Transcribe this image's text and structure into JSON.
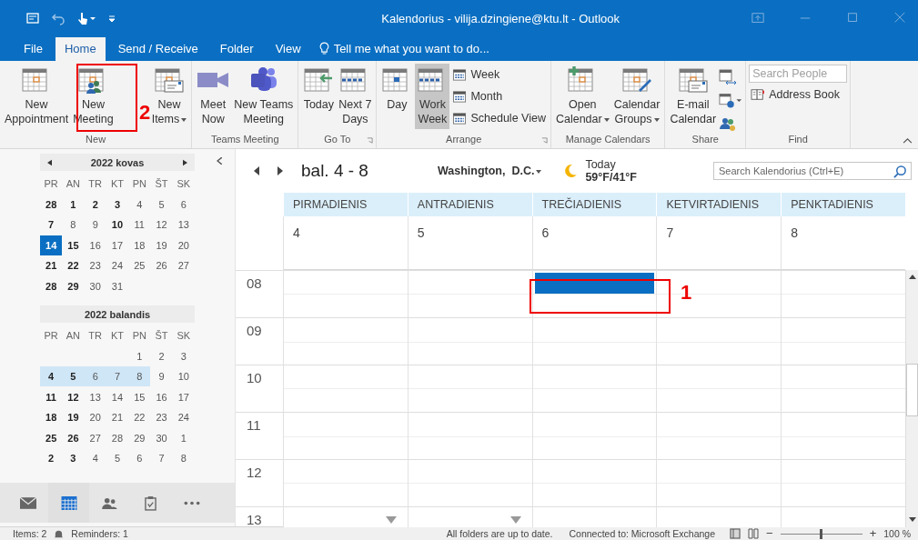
{
  "title_bar": {
    "title": "Kalendorius - vilija.dzingiene@ktu.lt - Outlook"
  },
  "tabs": [
    {
      "label": "File",
      "selected": false
    },
    {
      "label": "Home",
      "selected": true
    },
    {
      "label": "Send / Receive",
      "selected": false
    },
    {
      "label": "Folder",
      "selected": false
    },
    {
      "label": "View",
      "selected": false
    }
  ],
  "tell_me": {
    "placeholder": "Tell me what you want to do..."
  },
  "ribbon": {
    "groups": [
      {
        "label": "New",
        "buttons": [
          {
            "label": "New\nAppointment",
            "kind": "large"
          },
          {
            "label": "New\nMeeting",
            "kind": "large"
          },
          {
            "label": "New\nItems",
            "kind": "large",
            "dropdown": true
          }
        ]
      },
      {
        "label": "Teams Meeting",
        "buttons": [
          {
            "label": "Meet\nNow",
            "kind": "large"
          },
          {
            "label": "New Teams\nMeeting",
            "kind": "large"
          }
        ]
      },
      {
        "label": "Go To",
        "launcher": true,
        "buttons": [
          {
            "label": "Today",
            "kind": "large"
          },
          {
            "label": "Next 7\nDays",
            "kind": "large"
          }
        ]
      },
      {
        "label": "Arrange",
        "launcher": true,
        "buttons": [
          {
            "label": "Day",
            "kind": "large",
            "selected": false
          },
          {
            "label": "Work\nWeek",
            "kind": "large",
            "selected": true
          },
          {
            "label": "Week",
            "kind": "small",
            "selected": false
          },
          {
            "label": "Month",
            "kind": "small",
            "selected": false
          },
          {
            "label": "Schedule View",
            "kind": "small",
            "selected": false
          }
        ]
      },
      {
        "label": "Manage Calendars",
        "buttons": [
          {
            "label": "Open\nCalendar",
            "kind": "large",
            "dropdown": true
          },
          {
            "label": "Calendar\nGroups",
            "kind": "large",
            "dropdown": true
          }
        ]
      },
      {
        "label": "Share",
        "buttons": [
          {
            "label": "E-mail\nCalendar",
            "kind": "large"
          }
        ]
      },
      {
        "label": "Find",
        "buttons": [
          {
            "label": "Search People",
            "kind": "field"
          },
          {
            "label": "Address Book",
            "kind": "small"
          }
        ]
      }
    ]
  },
  "annotations": [
    {
      "number": "2"
    },
    {
      "number": "1"
    }
  ],
  "mini_calendars": [
    {
      "title": "2022 kovas",
      "nav": true,
      "weekdays": [
        "PR",
        "AN",
        "TR",
        "KT",
        "PN",
        "ŠT",
        "SK"
      ],
      "weeks": [
        [
          {
            "day": "28",
            "bold": true,
            "today": false,
            "selected": false
          },
          {
            "day": "1",
            "bold": true,
            "today": false,
            "selected": false
          },
          {
            "day": "2",
            "bold": true,
            "today": false,
            "selected": false
          },
          {
            "day": "3",
            "bold": true,
            "today": false,
            "selected": false
          },
          {
            "day": "4",
            "bold": false,
            "today": false,
            "selected": false
          },
          {
            "day": "5",
            "bold": false,
            "today": false,
            "selected": false
          },
          {
            "day": "6",
            "bold": false,
            "today": false,
            "selected": false
          }
        ],
        [
          {
            "day": "7",
            "bold": true,
            "today": false,
            "selected": false
          },
          {
            "day": "8",
            "bold": false,
            "today": false,
            "selected": false
          },
          {
            "day": "9",
            "bold": false,
            "today": false,
            "selected": false
          },
          {
            "day": "10",
            "bold": true,
            "today": false,
            "selected": false
          },
          {
            "day": "11",
            "bold": false,
            "today": false,
            "selected": false
          },
          {
            "day": "12",
            "bold": false,
            "today": false,
            "selected": false
          },
          {
            "day": "13",
            "bold": false,
            "today": false,
            "selected": false
          }
        ],
        [
          {
            "day": "14",
            "bold": true,
            "today": true,
            "selected": false
          },
          {
            "day": "15",
            "bold": true,
            "today": false,
            "selected": false
          },
          {
            "day": "16",
            "bold": false,
            "today": false,
            "selected": false
          },
          {
            "day": "17",
            "bold": false,
            "today": false,
            "selected": false
          },
          {
            "day": "18",
            "bold": false,
            "today": false,
            "selected": false
          },
          {
            "day": "19",
            "bold": false,
            "today": false,
            "selected": false
          },
          {
            "day": "20",
            "bold": false,
            "today": false,
            "selected": false
          }
        ],
        [
          {
            "day": "21",
            "bold": true,
            "today": false,
            "selected": false
          },
          {
            "day": "22",
            "bold": true,
            "today": false,
            "selected": false
          },
          {
            "day": "23",
            "bold": false,
            "today": false,
            "selected": false
          },
          {
            "day": "24",
            "bold": false,
            "today": false,
            "selected": false
          },
          {
            "day": "25",
            "bold": false,
            "today": false,
            "selected": false
          },
          {
            "day": "26",
            "bold": false,
            "today": false,
            "selected": false
          },
          {
            "day": "27",
            "bold": false,
            "today": false,
            "selected": false
          }
        ],
        [
          {
            "day": "28",
            "bold": true,
            "today": false,
            "selected": false
          },
          {
            "day": "29",
            "bold": true,
            "today": false,
            "selected": false
          },
          {
            "day": "30",
            "bold": false,
            "today": false,
            "selected": false
          },
          {
            "day": "31",
            "bold": false,
            "today": false,
            "selected": false
          }
        ]
      ]
    },
    {
      "title": "2022 balandis",
      "nav": false,
      "weekdays": [
        "PR",
        "AN",
        "TR",
        "KT",
        "PN",
        "ŠT",
        "SK"
      ],
      "weeks": [
        [
          {
            "day": "1",
            "bold": false,
            "today": false,
            "selected": false
          },
          {
            "day": "2",
            "bold": false,
            "today": false,
            "selected": false
          },
          {
            "day": "3",
            "bold": false,
            "today": false,
            "selected": false
          }
        ],
        [
          {
            "day": "4",
            "bold": true,
            "today": false,
            "selected": true
          },
          {
            "day": "5",
            "bold": true,
            "today": false,
            "selected": true
          },
          {
            "day": "6",
            "bold": false,
            "today": false,
            "selected": true
          },
          {
            "day": "7",
            "bold": false,
            "today": false,
            "selected": true
          },
          {
            "day": "8",
            "bold": false,
            "today": false,
            "selected": true
          },
          {
            "day": "9",
            "bold": false,
            "today": false,
            "selected": false
          },
          {
            "day": "10",
            "bold": false,
            "today": false,
            "selected": false
          }
        ],
        [
          {
            "day": "11",
            "bold": true,
            "today": false,
            "selected": false
          },
          {
            "day": "12",
            "bold": true,
            "today": false,
            "selected": false
          },
          {
            "day": "13",
            "bold": false,
            "today": false,
            "selected": false
          },
          {
            "day": "14",
            "bold": false,
            "today": false,
            "selected": false
          },
          {
            "day": "15",
            "bold": false,
            "today": false,
            "selected": false
          },
          {
            "day": "16",
            "bold": false,
            "today": false,
            "selected": false
          },
          {
            "day": "17",
            "bold": false,
            "today": false,
            "selected": false
          }
        ],
        [
          {
            "day": "18",
            "bold": true,
            "today": false,
            "selected": false
          },
          {
            "day": "19",
            "bold": true,
            "today": false,
            "selected": false
          },
          {
            "day": "20",
            "bold": false,
            "today": false,
            "selected": false
          },
          {
            "day": "21",
            "bold": false,
            "today": false,
            "selected": false
          },
          {
            "day": "22",
            "bold": false,
            "today": false,
            "selected": false
          },
          {
            "day": "23",
            "bold": false,
            "today": false,
            "selected": false
          },
          {
            "day": "24",
            "bold": false,
            "today": false,
            "selected": false
          }
        ],
        [
          {
            "day": "25",
            "bold": true,
            "today": false,
            "selected": false
          },
          {
            "day": "26",
            "bold": true,
            "today": false,
            "selected": false
          },
          {
            "day": "27",
            "bold": false,
            "today": false,
            "selected": false
          },
          {
            "day": "28",
            "bold": false,
            "today": false,
            "selected": false
          },
          {
            "day": "29",
            "bold": false,
            "today": false,
            "selected": false
          },
          {
            "day": "30",
            "bold": false,
            "today": false,
            "selected": false
          },
          {
            "day": "1",
            "bold": false,
            "today": false,
            "selected": false
          }
        ],
        [
          {
            "day": "2",
            "bold": true,
            "today": false,
            "selected": false
          },
          {
            "day": "3",
            "bold": true,
            "today": false,
            "selected": false
          },
          {
            "day": "4",
            "bold": false,
            "today": false,
            "selected": false
          },
          {
            "day": "5",
            "bold": false,
            "today": false,
            "selected": false
          },
          {
            "day": "6",
            "bold": false,
            "today": false,
            "selected": false
          },
          {
            "day": "7",
            "bold": false,
            "today": false,
            "selected": false
          },
          {
            "day": "8",
            "bold": false,
            "today": false,
            "selected": false
          }
        ]
      ]
    }
  ],
  "nav_bar": [
    {
      "kind": "mail",
      "selected": false
    },
    {
      "kind": "calendar",
      "selected": true
    },
    {
      "kind": "people",
      "selected": false
    },
    {
      "kind": "tasks",
      "selected": false
    },
    {
      "kind": "more",
      "selected": false
    }
  ],
  "calendar": {
    "range": "bal. 4 - 8",
    "location": "Washington,  D.C.",
    "weather_label": "Today",
    "temperature": "59°F/41°F",
    "search": {
      "placeholder": "Search Kalendorius (Ctrl+E)"
    },
    "days": [
      {
        "name": "PIRMADIENIS",
        "date": "4",
        "more_below": true
      },
      {
        "name": "ANTRADIENIS",
        "date": "5",
        "more_below": true
      },
      {
        "name": "TREČIADIENIS",
        "date": "6",
        "more_below": false
      },
      {
        "name": "KETVIRTADIENIS",
        "date": "7",
        "more_below": false
      },
      {
        "name": "PENKTADIENIS",
        "date": "8",
        "more_below": false
      }
    ],
    "hours": [
      {
        "label": "08",
        "slots": [
          {
            "selected": false
          },
          {
            "selected": false
          },
          {
            "selected": true
          },
          {
            "selected": false
          },
          {
            "selected": false
          }
        ]
      },
      {
        "label": "09",
        "slots": [
          {
            "selected": false
          },
          {
            "selected": false
          },
          {
            "selected": false
          },
          {
            "selected": false
          },
          {
            "selected": false
          }
        ]
      },
      {
        "label": "10",
        "slots": [
          {
            "selected": false
          },
          {
            "selected": false
          },
          {
            "selected": false
          },
          {
            "selected": false
          },
          {
            "selected": false
          }
        ]
      },
      {
        "label": "11",
        "slots": [
          {
            "selected": false
          },
          {
            "selected": false
          },
          {
            "selected": false
          },
          {
            "selected": false
          },
          {
            "selected": false
          }
        ]
      },
      {
        "label": "12",
        "slots": [
          {
            "selected": false
          },
          {
            "selected": false
          },
          {
            "selected": false
          },
          {
            "selected": false
          },
          {
            "selected": false
          }
        ]
      },
      {
        "label": "13",
        "slots": [
          {
            "selected": false
          },
          {
            "selected": false
          },
          {
            "selected": false
          },
          {
            "selected": false
          },
          {
            "selected": false
          }
        ]
      }
    ]
  },
  "status_bar": {
    "items": "Items: 2",
    "reminders": "Reminders: 1",
    "sync": "All folders are up to date.",
    "connection": "Connected to: Microsoft Exchange",
    "zoom_out": "−",
    "zoom_in": "+",
    "zoom": "100 %",
    "zoom_level": {
      "level": 0.5
    }
  }
}
